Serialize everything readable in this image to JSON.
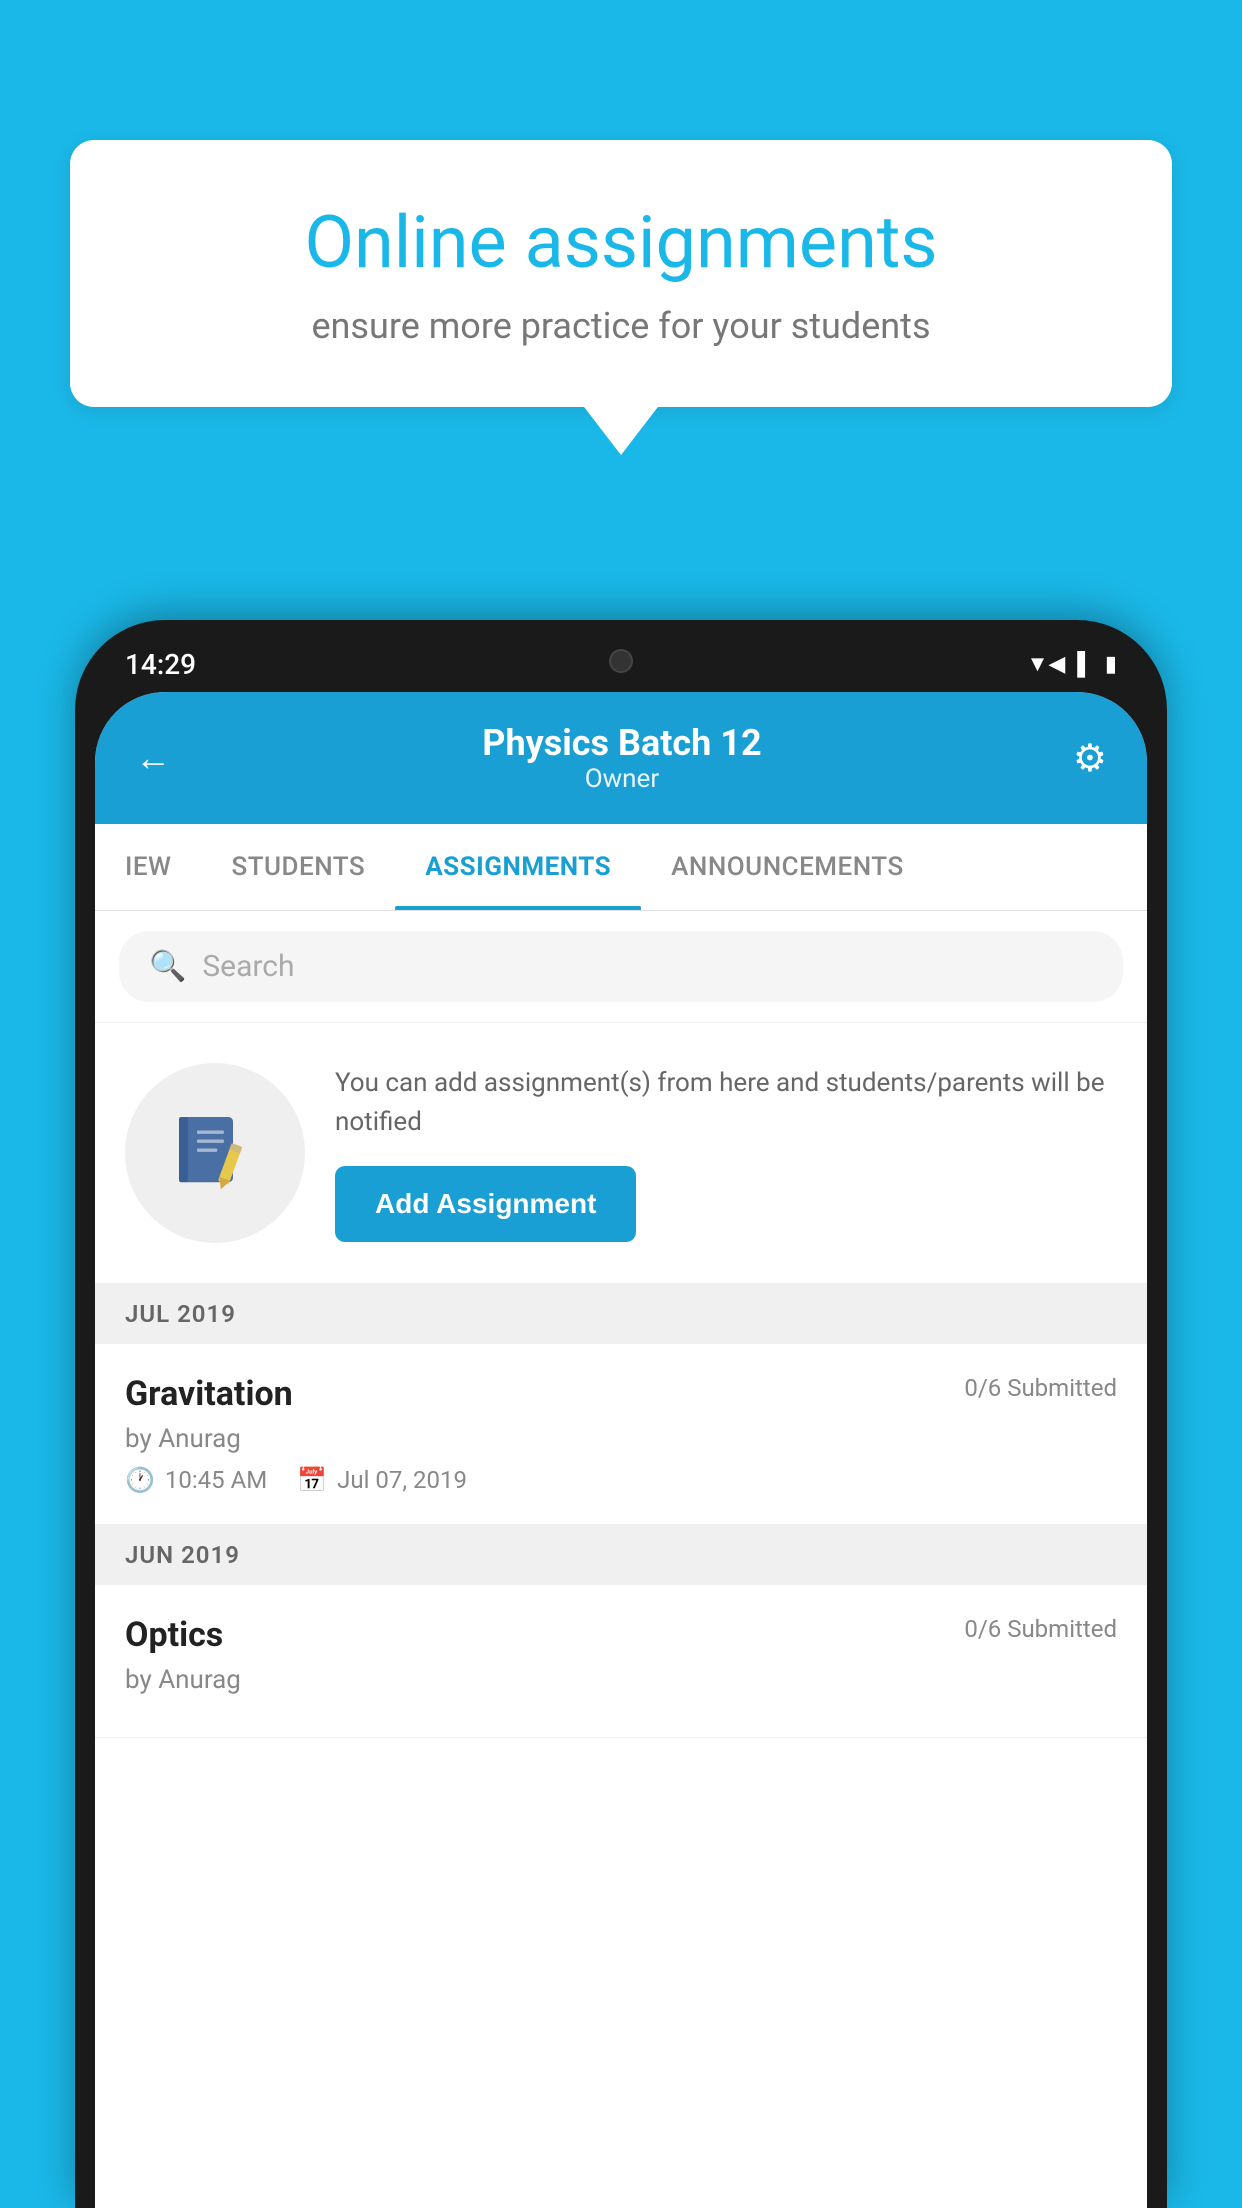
{
  "background_color": "#1ab8e8",
  "speech_bubble": {
    "title": "Online assignments",
    "subtitle": "ensure more practice for your students"
  },
  "status_bar": {
    "time": "14:29",
    "icons": [
      "wifi",
      "signal",
      "battery"
    ]
  },
  "header": {
    "title": "Physics Batch 12",
    "subtitle": "Owner",
    "back_label": "←",
    "settings_label": "⚙"
  },
  "tabs": [
    {
      "id": "view",
      "label": "IEW",
      "active": false
    },
    {
      "id": "students",
      "label": "STUDENTS",
      "active": false
    },
    {
      "id": "assignments",
      "label": "ASSIGNMENTS",
      "active": true
    },
    {
      "id": "announcements",
      "label": "ANNOUNCEMENTS",
      "active": false
    }
  ],
  "search": {
    "placeholder": "Search"
  },
  "add_assignment_section": {
    "description": "You can add assignment(s) from here and students/parents will be notified",
    "button_label": "Add Assignment"
  },
  "assignment_groups": [
    {
      "month_label": "JUL 2019",
      "assignments": [
        {
          "title": "Gravitation",
          "submitted": "0/6 Submitted",
          "author": "by Anurag",
          "time": "10:45 AM",
          "date": "Jul 07, 2019"
        }
      ]
    },
    {
      "month_label": "JUN 2019",
      "assignments": [
        {
          "title": "Optics",
          "submitted": "0/6 Submitted",
          "author": "by Anurag",
          "time": "",
          "date": ""
        }
      ]
    }
  ]
}
